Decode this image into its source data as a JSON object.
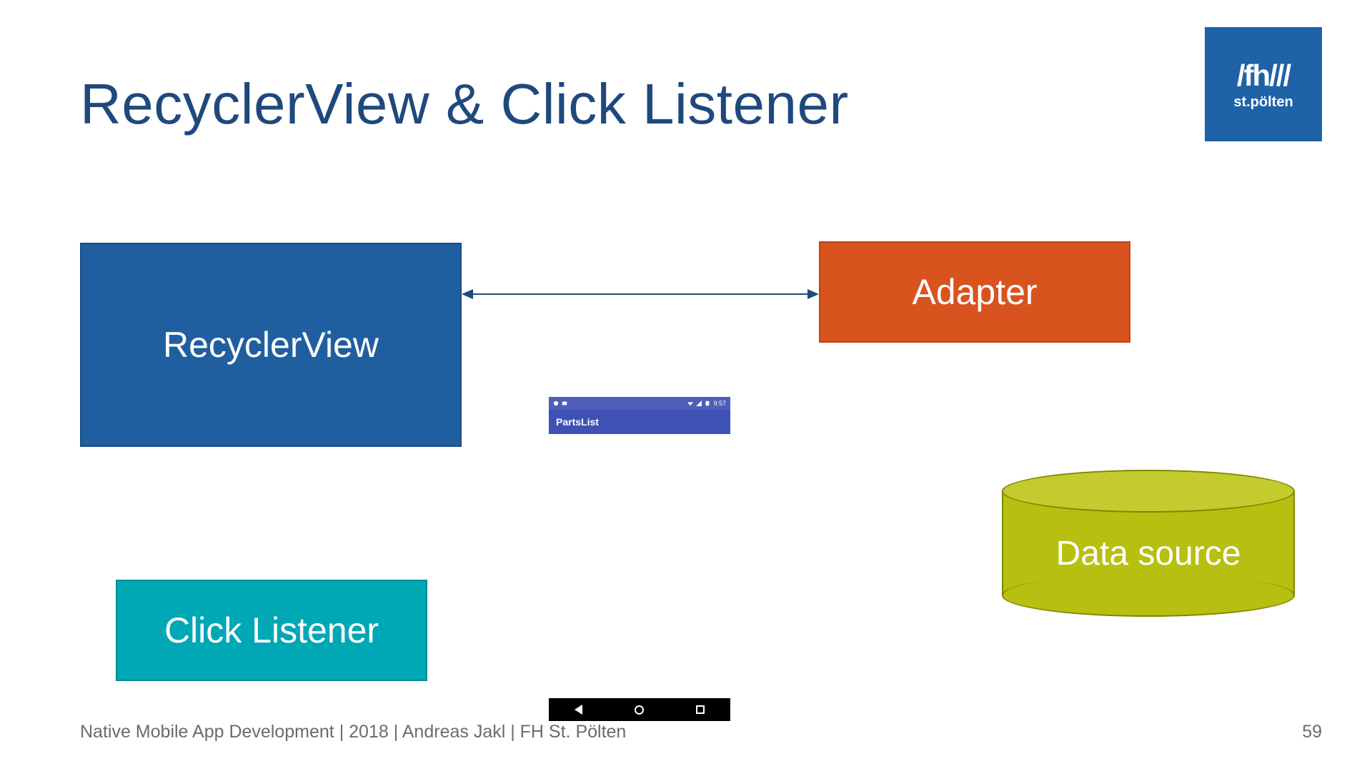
{
  "title": "RecyclerView & Click Listener",
  "logo": {
    "main": "/fh///",
    "sub": "st.pölten"
  },
  "boxes": {
    "recycler": "RecyclerView",
    "adapter": "Adapter",
    "clickListener": "Click Listener",
    "dataSource": "Data source"
  },
  "phone": {
    "appTitle": "PartsList",
    "clock": "9:57"
  },
  "footer": "Native Mobile App Development | 2018 | Andreas Jakl | FH St. Pölten",
  "pageNumber": "59",
  "colors": {
    "titleText": "#1F497D",
    "recyclerFill": "#1F5FA0",
    "adapterFill": "#D9531E",
    "clickListenerFill": "#00A7B5",
    "cylinderFill": "#B7BF10",
    "logoFill": "#1F62A7",
    "phoneAppbar": "#3F51B5"
  }
}
